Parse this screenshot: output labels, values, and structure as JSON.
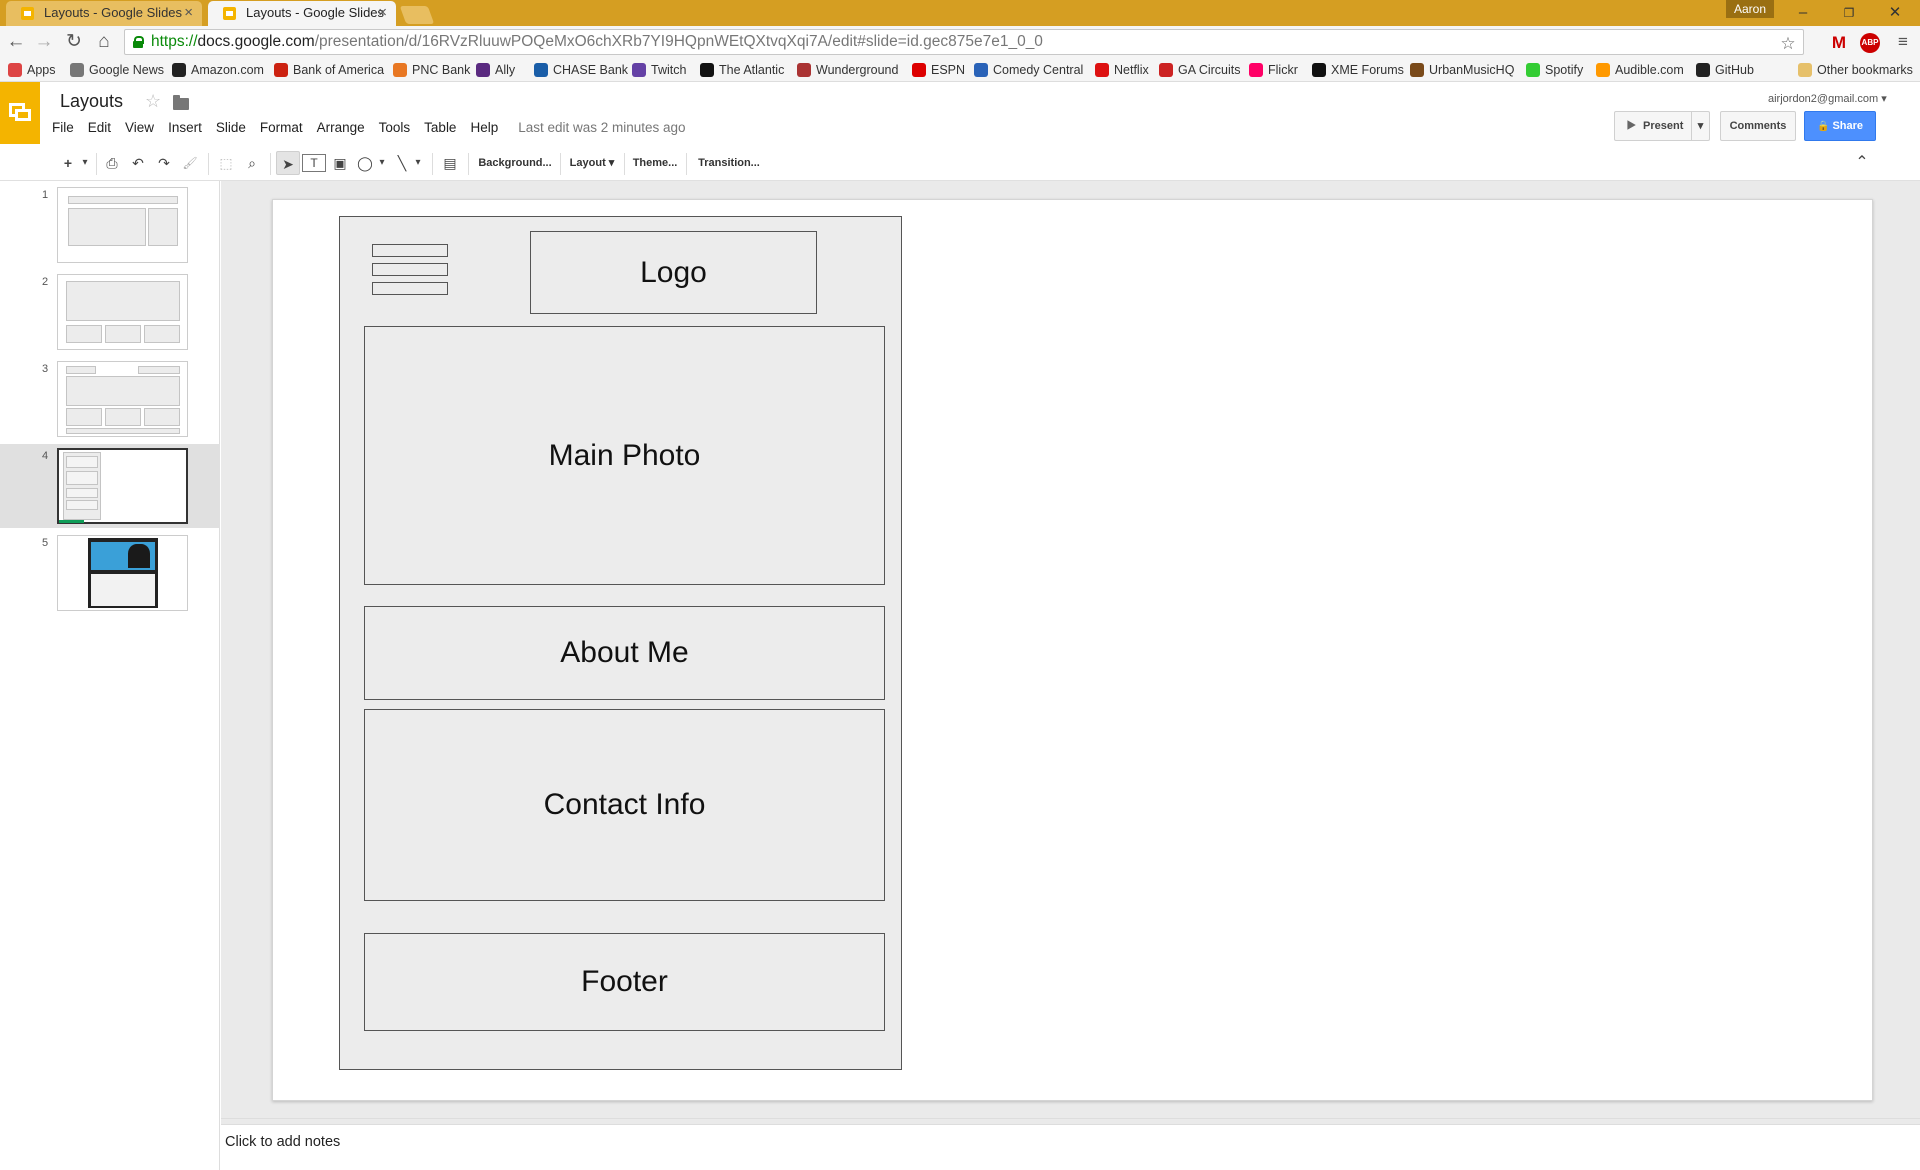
{
  "browser": {
    "tabs": [
      {
        "title": "Layouts - Google Slides",
        "active": false
      },
      {
        "title": "Layouts - Google Slides",
        "active": true
      }
    ],
    "user": "Aaron",
    "window_controls": {
      "minimize": "–",
      "restore": "❐",
      "close": "✕"
    },
    "url": {
      "protocol": "https://",
      "host": "docs.google.com",
      "path": "/presentation/d/16RVzRluuwPOQeMxO6chXRb7YI9HQpnWEtQXtvqXqi7A/edit#slide=id.gec875e7e1_0_0"
    },
    "nav": {
      "back": "←",
      "forward": "→",
      "reload": "↻",
      "home": "⌂",
      "star": "☆",
      "menu": "≡"
    },
    "extensions": {
      "gmail": "M",
      "abp": "ABP"
    },
    "bookmarks": [
      {
        "label": "Apps",
        "color": "#d44"
      },
      {
        "label": "Google News",
        "color": "#777"
      },
      {
        "label": "Amazon.com",
        "color": "#222"
      },
      {
        "label": "Bank of America",
        "color": "#c21"
      },
      {
        "label": "PNC Bank",
        "color": "#e87722"
      },
      {
        "label": "Ally",
        "color": "#5a2a80"
      },
      {
        "label": "CHASE Bank",
        "color": "#1a5ea8"
      },
      {
        "label": "Twitch",
        "color": "#6441a5"
      },
      {
        "label": "The Atlantic",
        "color": "#111"
      },
      {
        "label": "Wunderground",
        "color": "#a33"
      },
      {
        "label": "ESPN",
        "color": "#d00"
      },
      {
        "label": "Comedy Central",
        "color": "#2a63b8"
      },
      {
        "label": "Netflix",
        "color": "#d11"
      },
      {
        "label": "GA Circuits",
        "color": "#c22"
      },
      {
        "label": "Flickr",
        "color": "#f06"
      },
      {
        "label": "XME Forums",
        "color": "#111"
      },
      {
        "label": "UrbanMusicHQ",
        "color": "#7a4a1a"
      },
      {
        "label": "Spotify",
        "color": "#3c3"
      },
      {
        "label": "Audible.com",
        "color": "#f90"
      },
      {
        "label": "GitHub",
        "color": "#222"
      }
    ],
    "other_bookmarks": "Other bookmarks"
  },
  "app": {
    "title": "Layouts",
    "menu": [
      "File",
      "Edit",
      "View",
      "Insert",
      "Slide",
      "Format",
      "Arrange",
      "Tools",
      "Table",
      "Help"
    ],
    "last_edit": "Last edit was 2 minutes ago",
    "account": "airjordon2@gmail.com ▾",
    "buttons": {
      "present": "Present",
      "comments": "Comments",
      "share": "Share"
    },
    "toolbar": {
      "new": "+",
      "print": "⎙",
      "undo": "↶",
      "redo": "↷",
      "paint": "🖌",
      "zoom": "⌕",
      "select": "➤",
      "textbox": "T",
      "image": "▣",
      "shape": "◯",
      "line": "╲",
      "comment": "▤",
      "background": "Background...",
      "layout": "Layout ▾",
      "theme": "Theme...",
      "transition": "Transition...",
      "collapse": "⌃"
    }
  },
  "filmstrip": {
    "slides": [
      {
        "number": "1"
      },
      {
        "number": "2"
      },
      {
        "number": "3"
      },
      {
        "number": "4",
        "selected": true
      },
      {
        "number": "5"
      }
    ]
  },
  "slide": {
    "boxes": {
      "logo": "Logo",
      "main_photo": "Main Photo",
      "about": "About Me",
      "contact": "Contact Info",
      "footer": "Footer"
    }
  },
  "notes": {
    "placeholder": "Click to add notes"
  },
  "colors": {
    "accent": "#f4b400",
    "share_blue": "#4d90fe",
    "chrome_frame": "#d59e22"
  }
}
